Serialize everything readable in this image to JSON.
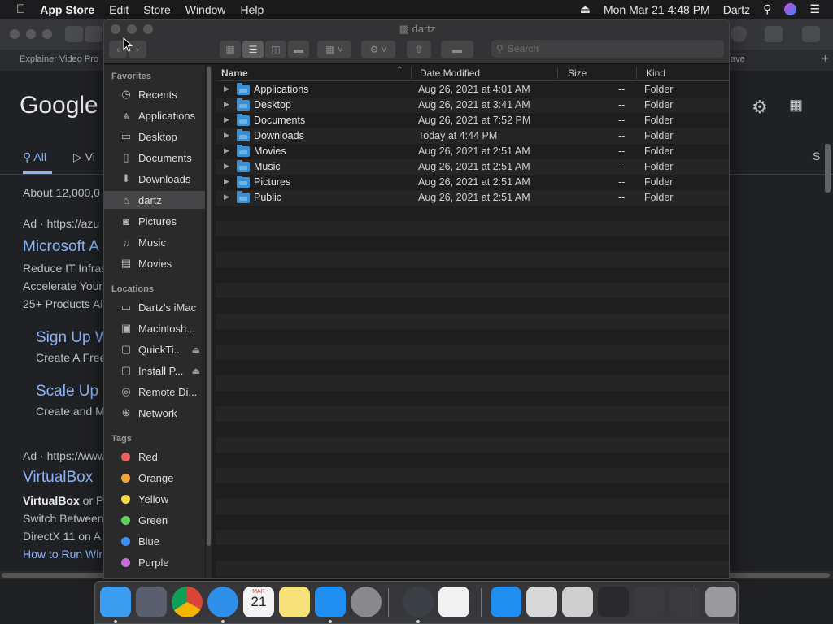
{
  "menubar": {
    "apple": "",
    "app_name": "App Store",
    "menus": [
      "Edit",
      "Store",
      "Window",
      "Help"
    ],
    "clock": "Mon Mar 21  4:48 PM",
    "user": "Dartz"
  },
  "browser": {
    "tab_left": "Explainer Video Pro",
    "tab_right": "ave"
  },
  "google": {
    "logo": "Google",
    "tab_all": "All",
    "tab_videos": "Vi",
    "result_count": "About 12,000,0",
    "right_s": "S",
    "ad1": "Ad · https://azu",
    "ad1_title": "Microsoft A",
    "ad1_line1": "Reduce IT Infras",
    "ad1_line2": "Accelerate Your",
    "ad1_line3": "25+ Products Al",
    "sub1_title": "Sign Up W",
    "sub1_text": "Create A Free",
    "sub2_title": "Scale Up",
    "sub2_text": "Create and M",
    "ad2": "Ad · https://www",
    "ad2_title": "VirtualBox",
    "ad2_line1_bold": "VirtualBox",
    "ad2_line1": " or P",
    "ad2_line2": "Switch Between",
    "ad2_line3": "DirectX 11 on A",
    "ad2_link": "How to Run Wir"
  },
  "finder": {
    "title": "dartz",
    "search_placeholder": "Search",
    "sidebar": {
      "favorites_header": "Favorites",
      "favorites": [
        {
          "label": "Recents",
          "icon": "clock-icon",
          "glyph": "◷"
        },
        {
          "label": "Applications",
          "icon": "applications-icon",
          "glyph": "⩓"
        },
        {
          "label": "Desktop",
          "icon": "desktop-icon",
          "glyph": "▭"
        },
        {
          "label": "Documents",
          "icon": "document-icon",
          "glyph": "▯"
        },
        {
          "label": "Downloads",
          "icon": "download-icon",
          "glyph": "⬇"
        },
        {
          "label": "dartz",
          "icon": "home-icon",
          "glyph": "⌂"
        },
        {
          "label": "Pictures",
          "icon": "camera-icon",
          "glyph": "◙"
        },
        {
          "label": "Music",
          "icon": "music-icon",
          "glyph": "♫"
        },
        {
          "label": "Movies",
          "icon": "film-icon",
          "glyph": "▤"
        }
      ],
      "locations_header": "Locations",
      "locations": [
        {
          "label": "Dartz's iMac",
          "icon": "imac-icon",
          "glyph": "▭"
        },
        {
          "label": "Macintosh...",
          "icon": "disk-icon",
          "glyph": "▣"
        },
        {
          "label": "QuickTi...",
          "icon": "disk-icon",
          "glyph": "▢",
          "eject": "⏏"
        },
        {
          "label": "Install P...",
          "icon": "disk-icon",
          "glyph": "▢",
          "eject": "⏏"
        },
        {
          "label": "Remote Di...",
          "icon": "disc-icon",
          "glyph": "◎"
        },
        {
          "label": "Network",
          "icon": "globe-icon",
          "glyph": "⊕"
        }
      ],
      "tags_header": "Tags",
      "tags": [
        {
          "label": "Red",
          "color": "#ec5f5d"
        },
        {
          "label": "Orange",
          "color": "#f3a33a"
        },
        {
          "label": "Yellow",
          "color": "#f5d93f"
        },
        {
          "label": "Green",
          "color": "#5ed05e"
        },
        {
          "label": "Blue",
          "color": "#3f8ff2"
        },
        {
          "label": "Purple",
          "color": "#c46fd8"
        }
      ]
    },
    "columns": {
      "name": "Name",
      "date": "Date Modified",
      "size": "Size",
      "kind": "Kind"
    },
    "rows": [
      {
        "name": "Applications",
        "date": "Aug 26, 2021 at 4:01 AM",
        "size": "--",
        "kind": "Folder"
      },
      {
        "name": "Desktop",
        "date": "Aug 26, 2021 at 3:41 AM",
        "size": "--",
        "kind": "Folder"
      },
      {
        "name": "Documents",
        "date": "Aug 26, 2021 at 7:52 PM",
        "size": "--",
        "kind": "Folder"
      },
      {
        "name": "Downloads",
        "date": "Today at 4:44 PM",
        "size": "--",
        "kind": "Folder"
      },
      {
        "name": "Movies",
        "date": "Aug 26, 2021 at 2:51 AM",
        "size": "--",
        "kind": "Folder"
      },
      {
        "name": "Music",
        "date": "Aug 26, 2021 at 2:51 AM",
        "size": "--",
        "kind": "Folder"
      },
      {
        "name": "Pictures",
        "date": "Aug 26, 2021 at 2:51 AM",
        "size": "--",
        "kind": "Folder"
      },
      {
        "name": "Public",
        "date": "Aug 26, 2021 at 2:51 AM",
        "size": "--",
        "kind": "Folder"
      }
    ]
  },
  "dock": {
    "calendar_month": "MAR",
    "calendar_day": "21",
    "apps": [
      {
        "name": "finder-icon",
        "color": "#3b9cf0"
      },
      {
        "name": "launchpad-icon",
        "color": "#5a5f6e"
      },
      {
        "name": "chrome-icon",
        "color": "#e9e9e9"
      },
      {
        "name": "safari-icon",
        "color": "#2f8ee8"
      },
      {
        "name": "calendar-icon",
        "color": "#f4f4f4"
      },
      {
        "name": "notes-icon",
        "color": "#f7e27a"
      },
      {
        "name": "app-store-icon",
        "color": "#1f8ef0"
      },
      {
        "name": "system-preferences-icon",
        "color": "#8a8a8e"
      },
      {
        "name": "quicktime-icon",
        "color": "#3b3f46"
      },
      {
        "name": "reminders-icon",
        "color": "#f2f2f2"
      },
      {
        "name": "app-store-download-icon",
        "color": "#1f8ef0"
      },
      {
        "name": "document-icon",
        "color": "#d8d8d8"
      },
      {
        "name": "recent-window-icon",
        "color": "#cfcfcf"
      },
      {
        "name": "recent-window-icon",
        "color": "#2a2a2c"
      },
      {
        "name": "recent-window-icon",
        "color": "#3a3a3c"
      },
      {
        "name": "recent-window-icon",
        "color": "#3a3a3c"
      },
      {
        "name": "trash-icon",
        "color": "#9a9a9c"
      }
    ]
  }
}
